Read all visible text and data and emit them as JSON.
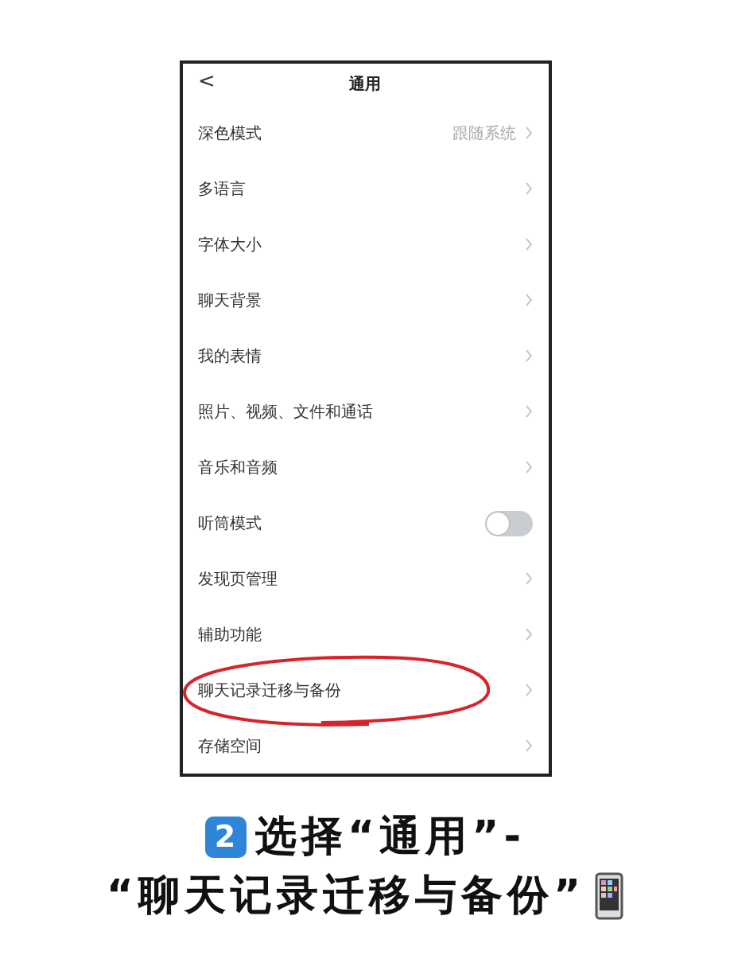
{
  "screen": {
    "back": "<",
    "title": "通用",
    "rows": [
      {
        "kind": "value",
        "label": "深色模式",
        "value": "跟随系统",
        "circled": false
      },
      {
        "kind": "link",
        "label": "多语言",
        "circled": false
      },
      {
        "kind": "link",
        "label": "字体大小",
        "circled": false
      },
      {
        "kind": "link",
        "label": "聊天背景",
        "circled": false
      },
      {
        "kind": "link",
        "label": "我的表情",
        "circled": false
      },
      {
        "kind": "link",
        "label": "照片、视频、文件和通话",
        "circled": false
      },
      {
        "kind": "link",
        "label": "音乐和音频",
        "circled": false
      },
      {
        "kind": "toggle",
        "label": "听筒模式",
        "on": false,
        "circled": false
      },
      {
        "kind": "link",
        "label": "发现页管理",
        "circled": false
      },
      {
        "kind": "link",
        "label": "辅助功能",
        "circled": false
      },
      {
        "kind": "link",
        "label": "聊天记录迁移与备份",
        "circled": true
      },
      {
        "kind": "link",
        "label": "存储空间",
        "circled": false
      }
    ]
  },
  "caption": {
    "step": "2",
    "line_1": "选择“通用”-",
    "line_2": "“聊天记录迁移与备份”"
  }
}
